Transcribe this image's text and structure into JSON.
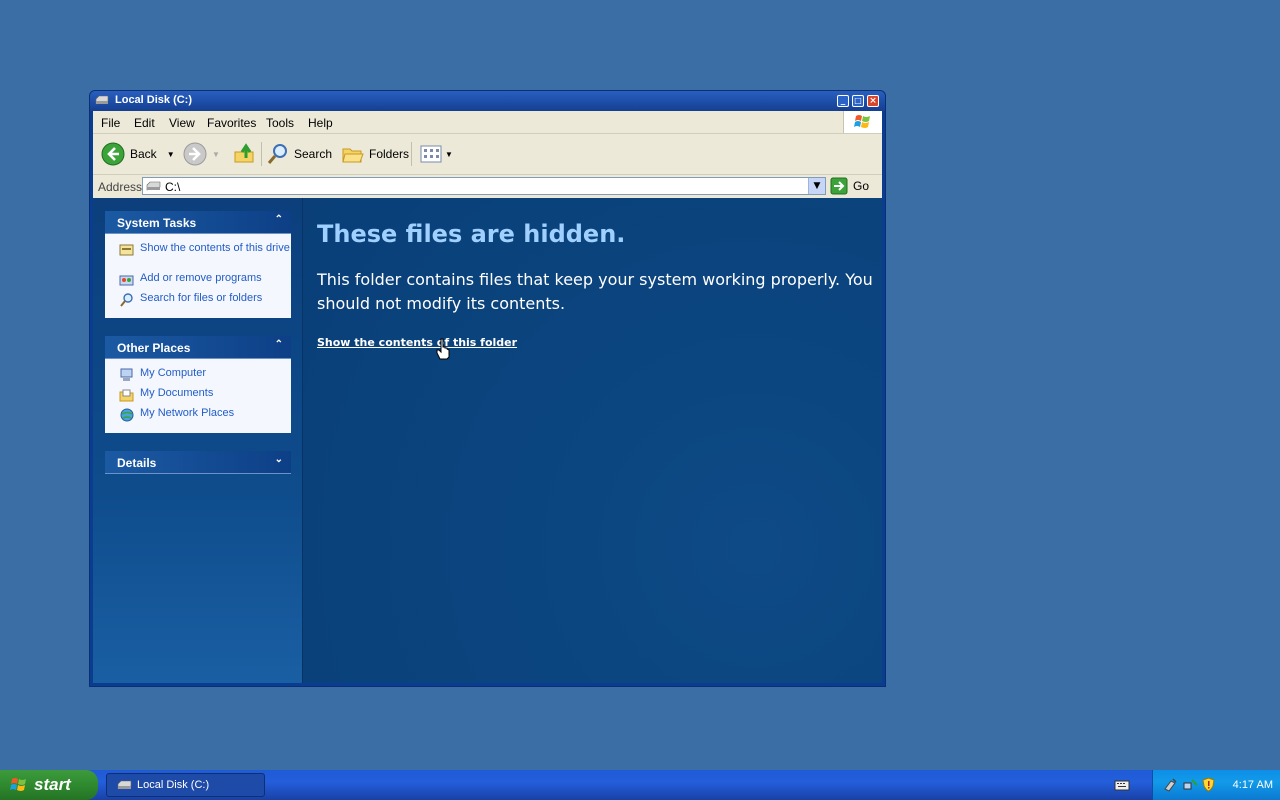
{
  "window": {
    "title": "Local Disk (C:)",
    "controls": {
      "minimize": "_",
      "maximize": "□",
      "close": "×"
    }
  },
  "menubar": [
    "File",
    "Edit",
    "View",
    "Favorites",
    "Tools",
    "Help"
  ],
  "toolbar": {
    "back_label": "Back",
    "search_label": "Search",
    "folders_label": "Folders"
  },
  "address": {
    "label": "Address",
    "value": "C:\\",
    "go_label": "Go"
  },
  "taskpane": {
    "system_tasks": {
      "title": "System Tasks",
      "items": [
        {
          "label": "Show the contents of this drive",
          "icon": "drive-contents-icon"
        },
        {
          "label": "Add or remove programs",
          "icon": "add-remove-programs-icon"
        },
        {
          "label": "Search for files or folders",
          "icon": "search-icon"
        }
      ]
    },
    "other_places": {
      "title": "Other Places",
      "items": [
        {
          "label": "My Computer",
          "icon": "my-computer-icon"
        },
        {
          "label": "My Documents",
          "icon": "my-documents-icon"
        },
        {
          "label": "My Network Places",
          "icon": "network-places-icon"
        }
      ]
    },
    "details": {
      "title": "Details"
    }
  },
  "main": {
    "heading": "These files are hidden.",
    "message": "This folder contains files that keep your system working properly. You should not modify its contents.",
    "show_link": "Show the contents of this folder"
  },
  "taskbar": {
    "start_label": "start",
    "task_button_label": "Local Disk (C:)",
    "clock": "4:17 AM"
  },
  "colors": {
    "desktop": "#3a6ea5",
    "content_bg": "#0e4a84",
    "heading": "#9fd0ff",
    "link": "#215dc6"
  }
}
